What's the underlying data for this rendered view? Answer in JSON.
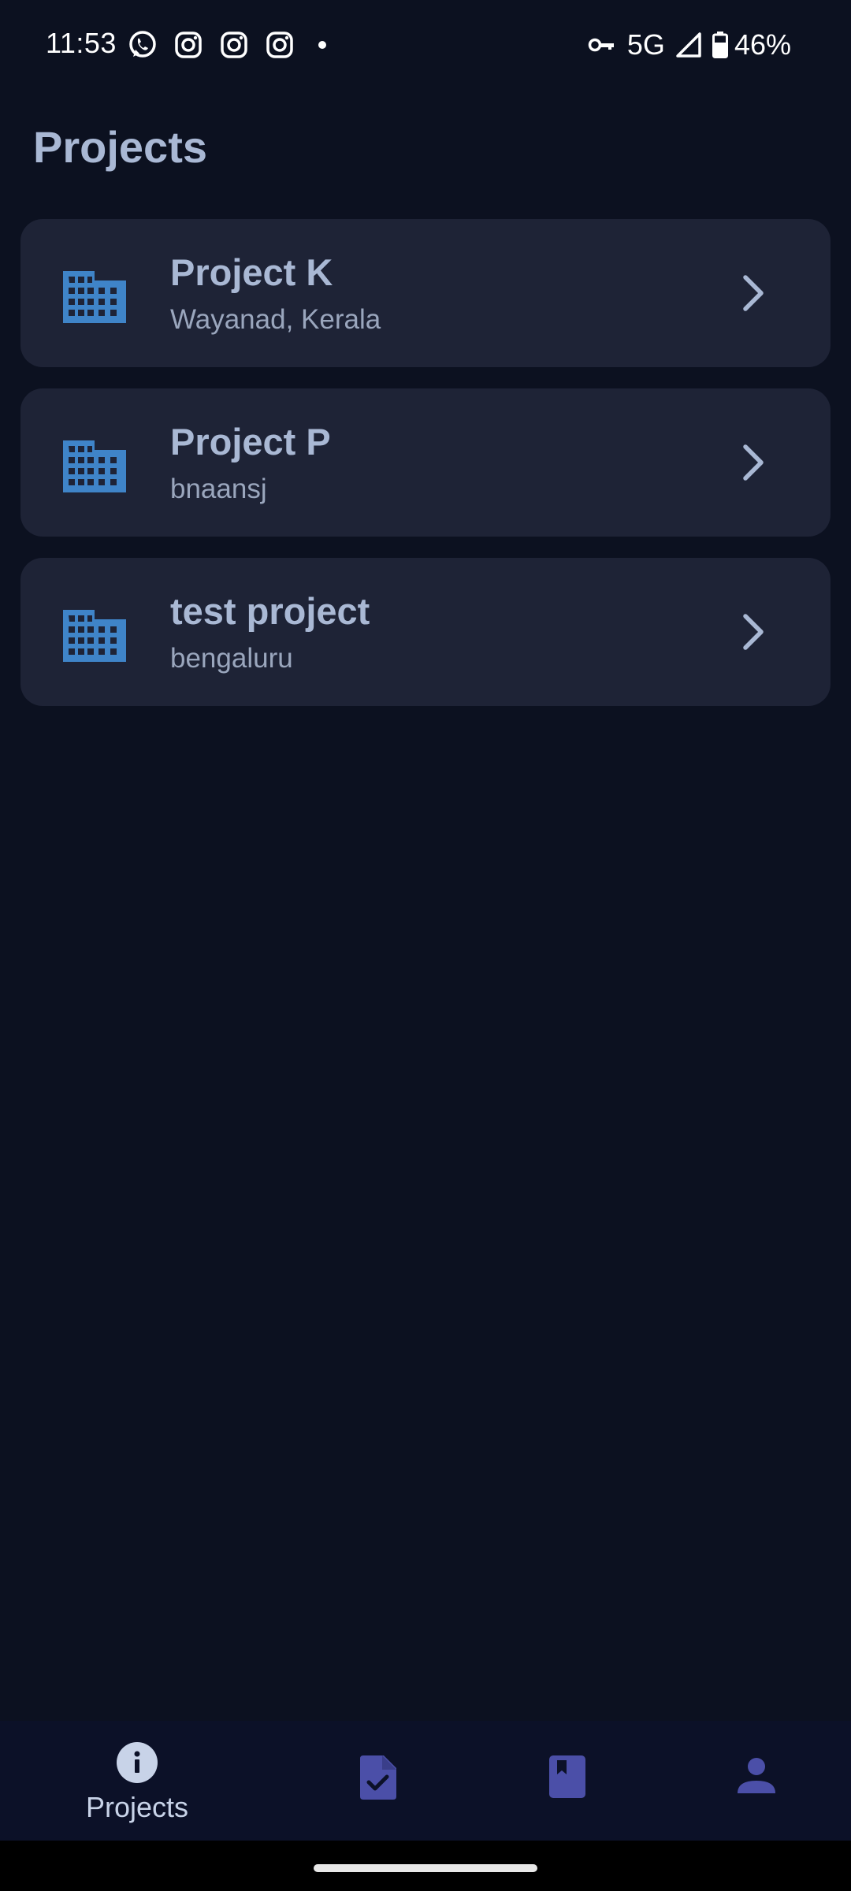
{
  "status_bar": {
    "time": "11:53",
    "notification_icons": [
      "whatsapp-icon",
      "instagram-icon",
      "instagram-icon",
      "instagram-icon"
    ],
    "network": "5G",
    "battery": "46%"
  },
  "header": {
    "title": "Projects"
  },
  "projects": [
    {
      "title": "Project K",
      "location": "Wayanad, Kerala",
      "icon": "building-icon"
    },
    {
      "title": "Project P",
      "location": "bnaansj",
      "icon": "building-icon"
    },
    {
      "title": "test project",
      "location": "bengaluru",
      "icon": "building-icon"
    }
  ],
  "bottom_nav": {
    "items": [
      {
        "label": "Projects",
        "icon": "info-icon",
        "active": true
      },
      {
        "label": "",
        "icon": "document-check-icon",
        "active": false
      },
      {
        "label": "",
        "icon": "bookmark-book-icon",
        "active": false
      },
      {
        "label": "",
        "icon": "person-icon",
        "active": false
      }
    ]
  },
  "colors": {
    "background": "#0c1120",
    "card": "#1e2336",
    "title_text": "#a9b8d4",
    "building_icon": "#3f84c8",
    "nav_icon": "#4b4fa8",
    "nav_active_icon": "#c8d3e8"
  }
}
